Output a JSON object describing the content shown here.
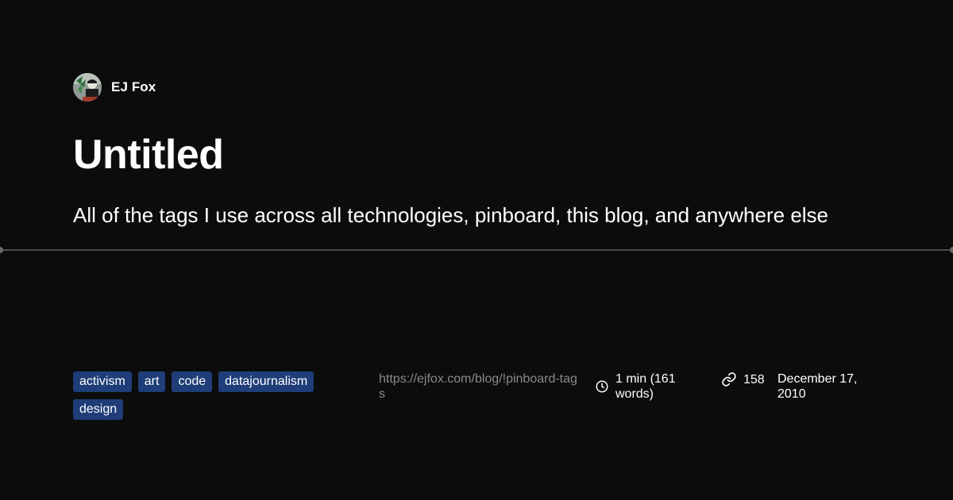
{
  "author": {
    "name": "EJ Fox",
    "avatar_icon": "avatar-photo"
  },
  "post": {
    "title": "Untitled",
    "description": "All of the tags I use across all technologies, pinboard, this blog, and anywhere else"
  },
  "tags": [
    "activism",
    "art",
    "code",
    "datajournalism",
    "design"
  ],
  "meta": {
    "url": "https://ejfox.com/blog/!pinboard-tags",
    "reading_time": "1 min (161 words)",
    "links_count": "158",
    "date": "December 17, 2010",
    "clock_icon": "clock-icon",
    "link_icon": "link-icon"
  },
  "colors": {
    "background": "#0c0c0c",
    "tag_bg": "#1f3d78",
    "url_text": "#8a8a8a",
    "divider": "#4a4a4a"
  }
}
